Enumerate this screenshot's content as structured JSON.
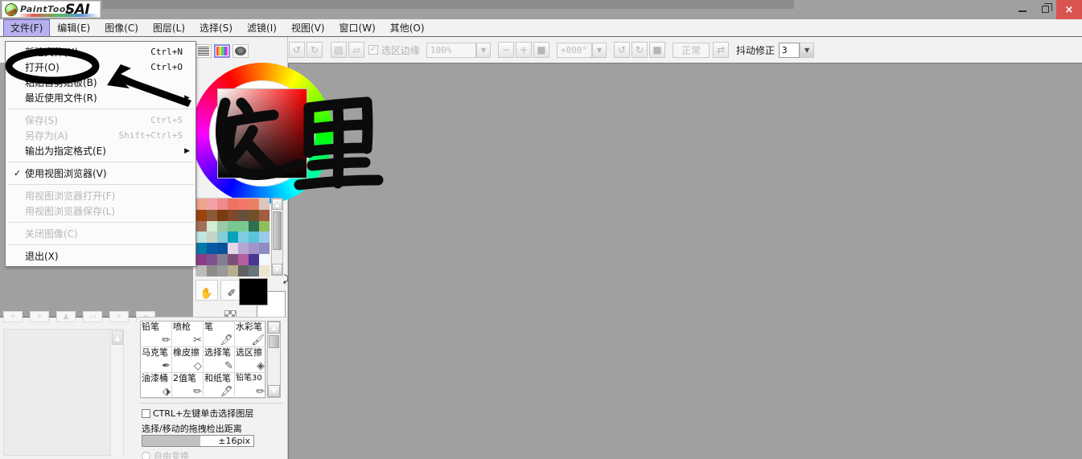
{
  "app": {
    "logo_paint": "PaintTool",
    "logo_sai": "SAI"
  },
  "window_controls": {
    "minimize": "minimize-icon",
    "maximize": "restore-icon",
    "close": "×"
  },
  "menubar": {
    "items": [
      {
        "label": "文件(F)",
        "active": true
      },
      {
        "label": "编辑(E)",
        "active": false
      },
      {
        "label": "图像(C)",
        "active": false
      },
      {
        "label": "图层(L)",
        "active": false
      },
      {
        "label": "选择(S)",
        "active": false
      },
      {
        "label": "滤镜(I)",
        "active": false
      },
      {
        "label": "视图(V)",
        "active": false
      },
      {
        "label": "窗口(W)",
        "active": false
      },
      {
        "label": "其他(O)",
        "active": false
      }
    ]
  },
  "file_menu": {
    "items": [
      {
        "label": "新建文件(N)",
        "accel": "Ctrl+N",
        "disabled": false,
        "submenu": false,
        "checked": false
      },
      {
        "label": "打开(O)",
        "accel": "Ctrl+O",
        "disabled": false,
        "submenu": false,
        "checked": false
      },
      {
        "label": "粘贴自剪贴板(B)",
        "accel": "",
        "disabled": false,
        "submenu": false,
        "checked": false
      },
      {
        "label": "最近使用文件(R)",
        "accel": "",
        "disabled": false,
        "submenu": true,
        "checked": false
      },
      {
        "separator": true
      },
      {
        "label": "保存(S)",
        "accel": "Ctrl+S",
        "disabled": true,
        "submenu": false,
        "checked": false
      },
      {
        "label": "另存为(A)",
        "accel": "Shift+Ctrl+S",
        "disabled": true,
        "submenu": false,
        "checked": false
      },
      {
        "label": "输出为指定格式(E)",
        "accel": "",
        "disabled": false,
        "submenu": true,
        "checked": false
      },
      {
        "separator": true
      },
      {
        "label": "使用视图浏览器(V)",
        "accel": "",
        "disabled": false,
        "submenu": false,
        "checked": true
      },
      {
        "separator": true
      },
      {
        "label": "用视图浏览器打开(F)",
        "accel": "",
        "disabled": true,
        "submenu": false,
        "checked": false
      },
      {
        "label": "用视图浏览器保存(L)",
        "accel": "",
        "disabled": true,
        "submenu": false,
        "checked": false
      },
      {
        "separator": true
      },
      {
        "label": "关闭图像(C)",
        "accel": "",
        "disabled": true,
        "submenu": false,
        "checked": false
      },
      {
        "separator": true
      },
      {
        "label": "退出(X)",
        "accel": "",
        "disabled": false,
        "submenu": false,
        "checked": false
      }
    ]
  },
  "optionsbar": {
    "undo_icon": "undo-icon",
    "redo_icon": "redo-icon",
    "selection_icon": "select-transform-icon",
    "deselect_icon": "deselect-icon",
    "selection_edge_label": "选区边缘",
    "selection_edge_checked": true,
    "zoom_value": "100%",
    "zoom_out_label": "−",
    "zoom_in_label": "+",
    "zoom_reset_label": "■",
    "rotate_value": "+000°",
    "rotate_ccw_label": "↺",
    "rotate_cw_label": "↻",
    "rotate_reset_label": "■",
    "blend_mode": "正常",
    "flip_icon": "flip-horizontal-icon",
    "stabilizer_label": "抖动修正",
    "stabilizer_value": "3"
  },
  "color_panel": {
    "mode_buttons": [
      {
        "name": "sliders-mode",
        "selected": false
      },
      {
        "name": "swatches-mode",
        "selected": true
      },
      {
        "name": "scratchpad-mode",
        "selected": false
      }
    ],
    "swatch_rows": [
      [
        "#efa48d",
        "#f4a0a6",
        "#ef8a8e",
        "#ee7264",
        "#f4766a",
        "#ec8062",
        "#dbc7c0"
      ],
      [
        "#9c4410",
        "#8c5a38",
        "#7c3a10",
        "#81472a",
        "#64503c",
        "#6f5228",
        "#a45b41"
      ],
      [
        "#a3705a",
        "#d5ecd0",
        "#9bcaa8",
        "#77c892",
        "#7cc98f",
        "#2e6f52",
        "#8fbf5a"
      ],
      [
        "#bfe4e2",
        "#c5d5c6",
        "#86ccd6",
        "#06a2bb",
        "#7fcde4",
        "#5ac5d8",
        "#9cc9ec"
      ],
      [
        "#0479ab",
        "#0759a4",
        "#0a509a",
        "#e4d7ea",
        "#b6a5ce",
        "#a094ca",
        "#8e8cc0"
      ],
      [
        "#8a3d85",
        "#7f5390",
        "#847e95",
        "#7c5077",
        "#b3609f",
        "#4a3592",
        "#f4f8ff"
      ],
      [
        "#bcbcbc",
        "#8f8c88",
        "#999a99",
        "#b7ad8f",
        "#616161",
        "#67747c",
        "#ece6cf"
      ]
    ],
    "foreground_color": "#000000",
    "background_color": "#ffffff",
    "swap_icon": "swap-colors-icon",
    "transparency_icon": "transparent-color-icon",
    "small_tools": [
      {
        "name": "hand-tool",
        "glyph": "✋"
      },
      {
        "name": "eyedropper-tool",
        "glyph": "✐"
      }
    ]
  },
  "brush_panel": {
    "brushes": [
      {
        "label": "铅笔",
        "icon": "pencil-icon"
      },
      {
        "label": "喷枪",
        "icon": "airbrush-icon"
      },
      {
        "label": "笔",
        "icon": "brush-icon"
      },
      {
        "label": "水彩笔",
        "icon": "watercolor-icon"
      },
      {
        "label": "马克笔",
        "icon": "marker-icon"
      },
      {
        "label": "橡皮擦",
        "icon": "eraser-icon"
      },
      {
        "label": "选择笔",
        "icon": "select-pen-icon"
      },
      {
        "label": "选区擦",
        "icon": "select-eraser-icon"
      },
      {
        "label": "油漆桶",
        "icon": "bucket-icon"
      },
      {
        "label": "2值笔",
        "icon": "binary-pen-icon"
      },
      {
        "label": "和纸笔",
        "icon": "washi-pen-icon"
      },
      {
        "label": "铅笔30",
        "icon": "pencil30-icon"
      }
    ],
    "ctrl_click_label": "CTRL+左键单击选择图层",
    "ctrl_click_checked": false,
    "drag_detect_label": "选择/移动的拖拽检出距离",
    "drag_detect_value": "±16pix",
    "free_transform_label": "自由变换"
  },
  "annotation": {
    "text": "这里",
    "meaning_note": "handwritten-ink-overlay",
    "circle_target": "打开(O)"
  }
}
